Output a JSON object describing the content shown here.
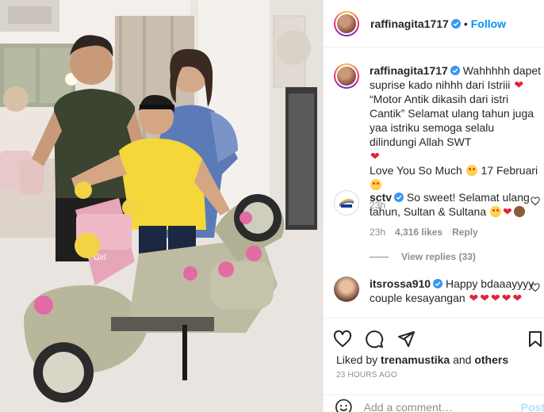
{
  "post": {
    "username": "raffinagita1717",
    "follow_label": "Follow",
    "separator": "•"
  },
  "caption": {
    "username": "raffinagita1717",
    "line1": "Wahhhhh dapet suprise kado nihhh dari Istriii",
    "line2": "“Motor Antik dikasih dari istri Cantik”",
    "line3": "Selamat ulang tahun juga yaa istriku semoga selalu dilindungi Allah SWT",
    "line4": "Love You So Much",
    "line5": "17 Februari",
    "time": "23h"
  },
  "comments": [
    {
      "username": "sctv",
      "text": "So sweet! Selamat ulang tahun, Sultan & Sultana",
      "time": "23h",
      "likes": "4,316 likes",
      "reply_label": "Reply",
      "view_replies": "View replies (33)"
    },
    {
      "username": "itsrossa910",
      "text": "Happy bdaaayyyy couple kesayangan"
    }
  ],
  "footer": {
    "liked_prefix": "Liked by",
    "liked_user": "trenamustika",
    "liked_and": "and",
    "liked_others": "others",
    "timestamp": "23 HOURS AGO",
    "comment_placeholder": "Add a comment…",
    "post_label": "Post"
  },
  "photo": {
    "plate_text": "Girl"
  },
  "colors": {
    "accent": "#0095f6",
    "heart": "#e0243a",
    "muted": "#8e8e8e"
  }
}
